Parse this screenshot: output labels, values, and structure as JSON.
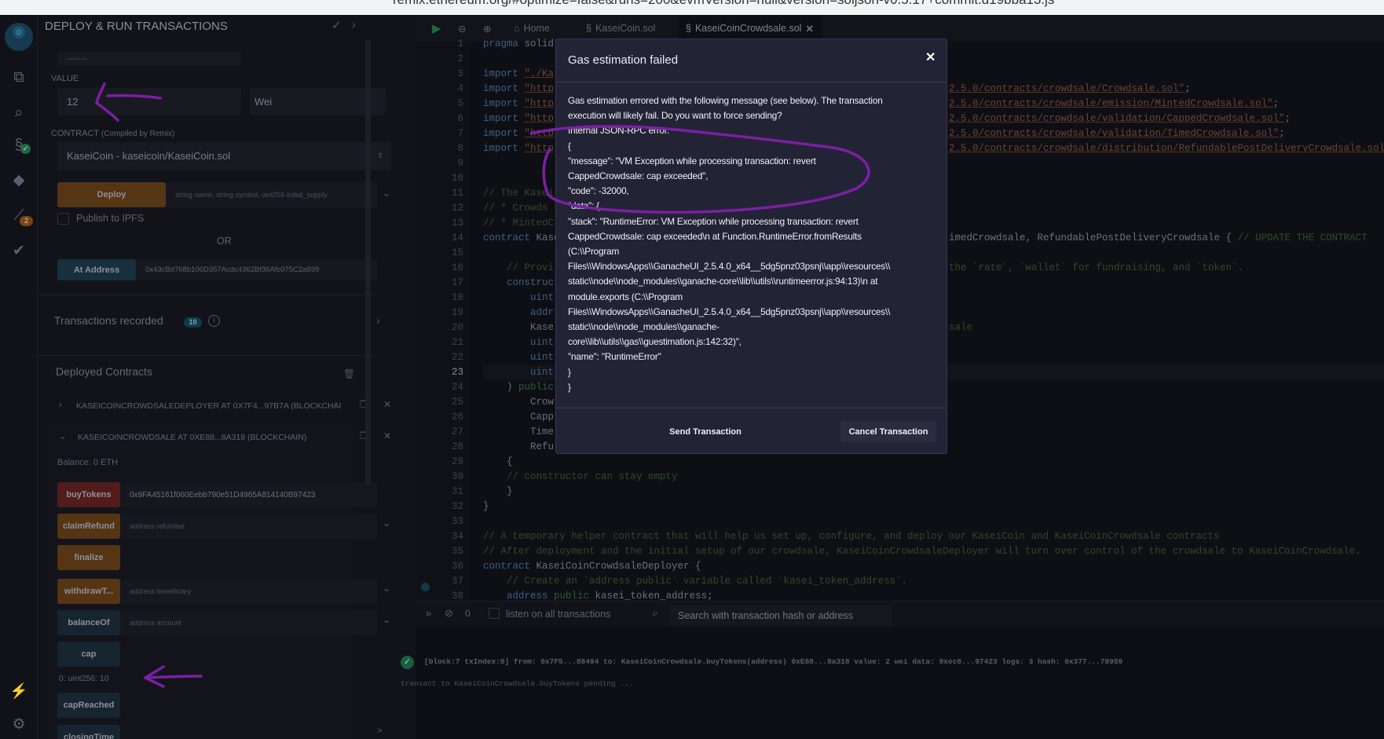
{
  "browser": {
    "url": "remix.ethereum.org/#optimize=false&runs=200&evmVersion=null&version=soljson-v0.5.17+commit.d19bba13.js"
  },
  "iconbar": {
    "analytics_badge": "2"
  },
  "sidebar": {
    "title": "DEPLOY & RUN TRANSACTIONS",
    "partial_field": "-------",
    "value_label": "VALUE",
    "value": "12",
    "unit": "Wei",
    "contract_label": "CONTRACT",
    "contract_sublabel": "(Compiled by Remix)",
    "contract_selected": "KaseiCoin - kaseicoin/KaseiCoin.sol",
    "deploy_label": "Deploy",
    "deploy_placeholder": "string name, string symbol, uint256 initial_supply",
    "publish_ipfs": "Publish to IPFS",
    "or": "OR",
    "at_address_label": "At Address",
    "at_address_value": "0x43cBd768b106D357Acdc4362Bf36Afc075C2a939",
    "tx_recorded": "Transactions recorded",
    "tx_count": "10",
    "deployed_title": "Deployed Contracts",
    "contracts": [
      {
        "name": "KASEICOINCROWDSALEDEPLOYER AT 0X7F4...97B7A (BLOCKCHAI"
      },
      {
        "name": "KASEICOINCROWDSALE AT 0XE88...8A318 (BLOCKCHAIN)"
      }
    ],
    "balance": "Balance: 0 ETH",
    "functions": [
      {
        "label": "buyTokens",
        "value": "0x9FA45161f060Eebb790e51D4965A814140B97423",
        "kind": "payable"
      },
      {
        "label": "claimRefund",
        "placeholder": "address refundee",
        "kind": "nonpayable"
      },
      {
        "label": "finalize",
        "kind": "nonpayable"
      },
      {
        "label": "withdrawT...",
        "placeholder": "address beneficiary",
        "kind": "nonpayable"
      },
      {
        "label": "balanceOf",
        "placeholder": "address account",
        "kind": "view"
      },
      {
        "label": "cap",
        "kind": "view"
      },
      {
        "label": "capReached",
        "kind": "view"
      },
      {
        "label": "closingTime",
        "kind": "view"
      }
    ],
    "cap_result": "0: uint256: 10"
  },
  "tabs": [
    {
      "label": "Home"
    },
    {
      "label": "KaseiCoin.sol"
    },
    {
      "label": "KaseiCoinCrowdsale.sol",
      "active": true
    }
  ],
  "code": [
    {
      "n": "1",
      "l": [
        [
          "k",
          "pragma"
        ],
        [
          "p",
          " solid"
        ]
      ]
    },
    {
      "n": "2",
      "l": []
    },
    {
      "n": "3",
      "l": [
        [
          "k",
          "import"
        ],
        [
          "p",
          " "
        ],
        [
          "s",
          "\"./Ka"
        ]
      ]
    },
    {
      "n": "4",
      "l": [
        [
          "k",
          "import"
        ],
        [
          "p",
          " "
        ],
        [
          "s",
          "\"http"
        ]
      ],
      "r": [
        [
          "s",
          "2.5.0/contracts/crowdsale/Crowdsale.sol\""
        ],
        [
          "p",
          ";"
        ]
      ]
    },
    {
      "n": "5",
      "l": [
        [
          "k",
          "import"
        ],
        [
          "p",
          " "
        ],
        [
          "s",
          "\"http"
        ]
      ],
      "r": [
        [
          "s",
          "2.5.0/contracts/crowdsale/emission/MintedCrowdsale.sol\""
        ],
        [
          "p",
          ";"
        ]
      ]
    },
    {
      "n": "6",
      "l": [
        [
          "k",
          "import"
        ],
        [
          "p",
          " "
        ],
        [
          "s",
          "\"http"
        ]
      ],
      "r": [
        [
          "s",
          "2.5.0/contracts/crowdsale/validation/CappedCrowdsale.sol\""
        ],
        [
          "p",
          ";"
        ]
      ]
    },
    {
      "n": "7",
      "l": [
        [
          "k",
          "import"
        ],
        [
          "p",
          " "
        ],
        [
          "s",
          "\"http"
        ]
      ],
      "r": [
        [
          "s",
          "2.5.0/contracts/crowdsale/validation/TimedCrowdsale.sol\""
        ],
        [
          "p",
          ";"
        ]
      ]
    },
    {
      "n": "8",
      "l": [
        [
          "k",
          "import"
        ],
        [
          "p",
          " "
        ],
        [
          "s",
          "\"http"
        ]
      ],
      "r": [
        [
          "s",
          "2.5.0/contracts/crowdsale/distribution/RefundablePostDeliveryCrowdsale.sol"
        ]
      ]
    },
    {
      "n": "9",
      "l": []
    },
    {
      "n": "10",
      "l": []
    },
    {
      "n": "11",
      "l": [
        [
          "c",
          "// The Kasei"
        ]
      ]
    },
    {
      "n": "12",
      "l": [
        [
          "c",
          "// * Crowds"
        ]
      ]
    },
    {
      "n": "13",
      "l": [
        [
          "c",
          "// * MintedC"
        ]
      ]
    },
    {
      "n": "14",
      "l": [
        [
          "k",
          "contract"
        ],
        [
          "p",
          " Kasei"
        ]
      ],
      "r": [
        [
          "p",
          "imedCrowdsale, RefundablePostDeliveryCrowdsale { "
        ],
        [
          "c",
          "// UPDATE THE CONTRACT"
        ]
      ]
    },
    {
      "n": "15",
      "l": []
    },
    {
      "n": "16",
      "l": [
        [
          "c",
          "    // Provi"
        ]
      ],
      "r": [
        [
          "c",
          "the `rate`, `wallet` for fundraising, and `token`."
        ]
      ]
    },
    {
      "n": "17",
      "l": [
        [
          "k",
          "    construct"
        ]
      ]
    },
    {
      "n": "18",
      "l": [
        [
          "t",
          "        uint"
        ]
      ]
    },
    {
      "n": "19",
      "l": [
        [
          "t",
          "        addr"
        ]
      ]
    },
    {
      "n": "20",
      "l": [
        [
          "p",
          "        Kase"
        ]
      ],
      "r": [
        [
          "c",
          "sale"
        ]
      ]
    },
    {
      "n": "21",
      "l": [
        [
          "t",
          "        uint"
        ]
      ]
    },
    {
      "n": "22",
      "l": [
        [
          "t",
          "        uint"
        ]
      ]
    },
    {
      "n": "23",
      "l": [
        [
          "t",
          "        uint"
        ]
      ]
    },
    {
      "n": "24",
      "l": [
        [
          "p",
          "    ) "
        ],
        [
          "g",
          "public"
        ]
      ]
    },
    {
      "n": "25",
      "l": [
        [
          "p",
          "        Crow"
        ]
      ]
    },
    {
      "n": "26",
      "l": [
        [
          "p",
          "        Capp"
        ]
      ]
    },
    {
      "n": "27",
      "l": [
        [
          "p",
          "        Time"
        ]
      ]
    },
    {
      "n": "28",
      "l": [
        [
          "p",
          "        Refu"
        ]
      ]
    },
    {
      "n": "29",
      "l": [
        [
          "p",
          "    {"
        ]
      ]
    },
    {
      "n": "30",
      "l": [
        [
          "c",
          "    // constructor can stay empty"
        ]
      ]
    },
    {
      "n": "31",
      "l": [
        [
          "p",
          "    }"
        ]
      ]
    },
    {
      "n": "32",
      "l": [
        [
          "p",
          "}"
        ]
      ]
    },
    {
      "n": "33",
      "l": []
    },
    {
      "n": "34",
      "l": [
        [
          "c",
          "// A temporary helper contract that will help us set up, configure, and deploy our KaseiCoin and KaseiCoinCrowdsale contracts"
        ]
      ]
    },
    {
      "n": "35",
      "l": [
        [
          "c",
          "// After deployment and the initial setup of our crowdsale, KaseiCoinCrowdsaleDeployer will turn over control of the crowdsale to KaseiCoinCrowdsale."
        ]
      ]
    },
    {
      "n": "36",
      "l": [
        [
          "k",
          "contract"
        ],
        [
          "p",
          " KaseiCoinCrowdsaleDeployer {"
        ]
      ]
    },
    {
      "n": "37",
      "l": [
        [
          "c",
          "    // Create an `address public` variable called `kasei_token_address`."
        ]
      ]
    },
    {
      "n": "38",
      "l": [
        [
          "t",
          "    address"
        ],
        [
          "p",
          " "
        ],
        [
          "g",
          "public"
        ],
        [
          "p",
          " kasei_token_address;"
        ]
      ]
    }
  ],
  "terminal": {
    "count": "0",
    "listen_label": "listen on all transactions",
    "search_placeholder": "Search with transaction hash or address",
    "log": "[block:7 txIndex:0]  from: 0x7F5...88494 to: KaseiCoinCrowdsale.buyTokens(address) 0xE88...8a318 value: 2 wei data: 0xec8...97423 logs: 3 hash: 0x377...78959",
    "pending": "transact to KaseiCoinCrowdsale.buyTokens pending ...",
    "prompt": ">"
  },
  "modal": {
    "title": "Gas estimation failed",
    "lines": [
      "Gas estimation errored with the following message (see below). The transaction",
      "execution will likely fail. Do you want to force sending?",
      "Internal JSON-RPC error.",
      "{",
      "\"message\": \"VM Exception while processing transaction: revert",
      "CappedCrowdsale: cap exceeded\",",
      "\"code\": -32000,",
      "\"data\": {",
      "\"stack\": \"RuntimeError: VM Exception while processing transaction: revert",
      "CappedCrowdsale: cap exceeded\\n at Function.RuntimeError.fromResults",
      "(C:\\\\Program",
      "Files\\\\WindowsApps\\\\GanacheUI_2.5.4.0_x64__5dg5pnz03psnj\\\\app\\\\resources\\\\",
      "static\\\\node\\\\node_modules\\\\ganache-core\\\\lib\\\\utils\\\\runtimeerror.js:94:13)\\n at",
      "module.exports (C:\\\\Program",
      "Files\\\\WindowsApps\\\\GanacheUI_2.5.4.0_x64__5dg5pnz03psnj\\\\app\\\\resources\\\\",
      "static\\\\node\\\\node_modules\\\\ganache-",
      "core\\\\lib\\\\utils\\\\gas\\\\guestimation.js:142:32)\",",
      "\"name\": \"RuntimeError\"",
      "}",
      "}"
    ],
    "send_label": "Send Transaction",
    "cancel_label": "Cancel Transaction"
  },
  "colors": {
    "annotation": "#7b1fa2",
    "payable": "#531c1c",
    "nonpayable": "#553514",
    "view": "#16252f",
    "success": "#1e7a4e"
  }
}
